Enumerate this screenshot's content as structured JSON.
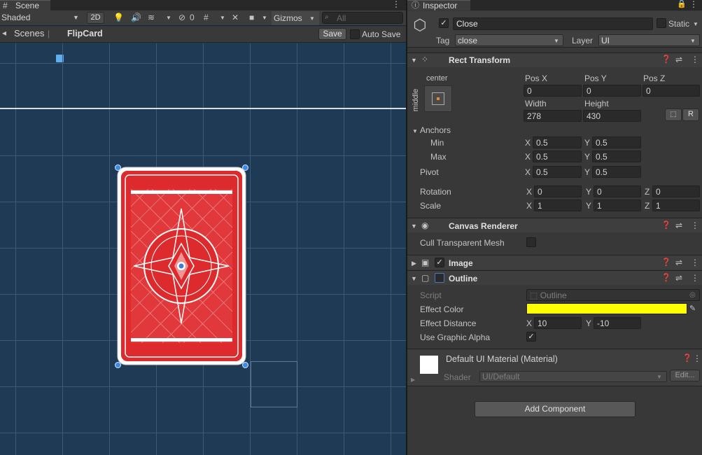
{
  "scene": {
    "tab": "Scene",
    "shading": "Shaded",
    "mode_2d": "2D",
    "hidden_count": "0",
    "gizmos": "Gizmos",
    "search_placeholder": "All",
    "breadcrumb_root": "Scenes",
    "breadcrumb_prefab": "FlipCard",
    "save": "Save",
    "auto_save": "Auto Save"
  },
  "inspector": {
    "tab": "Inspector",
    "object_name": "Close",
    "static_label": "Static",
    "tag_label": "Tag",
    "tag_value": "close",
    "layer_label": "Layer",
    "layer_value": "UI"
  },
  "rect_transform": {
    "title": "Rect Transform",
    "anchor_h": "center",
    "anchor_v": "middle",
    "pos_x_label": "Pos X",
    "pos_y_label": "Pos Y",
    "pos_z_label": "Pos Z",
    "pos_x": "0",
    "pos_y": "0",
    "pos_z": "0",
    "width_label": "Width",
    "height_label": "Height",
    "width": "278",
    "height": "430",
    "r_button": "R",
    "anchors_label": "Anchors",
    "min_label": "Min",
    "max_label": "Max",
    "min_x": "0.5",
    "min_y": "0.5",
    "max_x": "0.5",
    "max_y": "0.5",
    "pivot_label": "Pivot",
    "pivot_x": "0.5",
    "pivot_y": "0.5",
    "rotation_label": "Rotation",
    "rot_x": "0",
    "rot_y": "0",
    "rot_z": "0",
    "scale_label": "Scale",
    "scale_x": "1",
    "scale_y": "1",
    "scale_z": "1",
    "x": "X",
    "y": "Y",
    "z": "Z"
  },
  "canvas_renderer": {
    "title": "Canvas Renderer",
    "cull_label": "Cull Transparent Mesh"
  },
  "image": {
    "title": "Image"
  },
  "outline": {
    "title": "Outline",
    "script_label": "Script",
    "script_value": "Outline",
    "effect_color_label": "Effect Color",
    "effect_color": "#ffff00",
    "effect_distance_label": "Effect Distance",
    "dist_x": "10",
    "dist_y": "-10",
    "use_graphic_alpha_label": "Use Graphic Alpha"
  },
  "material": {
    "title": "Default UI Material (Material)",
    "shader_label": "Shader",
    "shader_value": "UI/Default",
    "edit": "Edit..."
  },
  "add_component": "Add Component",
  "colors": {
    "scene_bg": "#1f3a55",
    "card_red": "#dd2a2d",
    "handle_blue": "#3c8ae8"
  }
}
